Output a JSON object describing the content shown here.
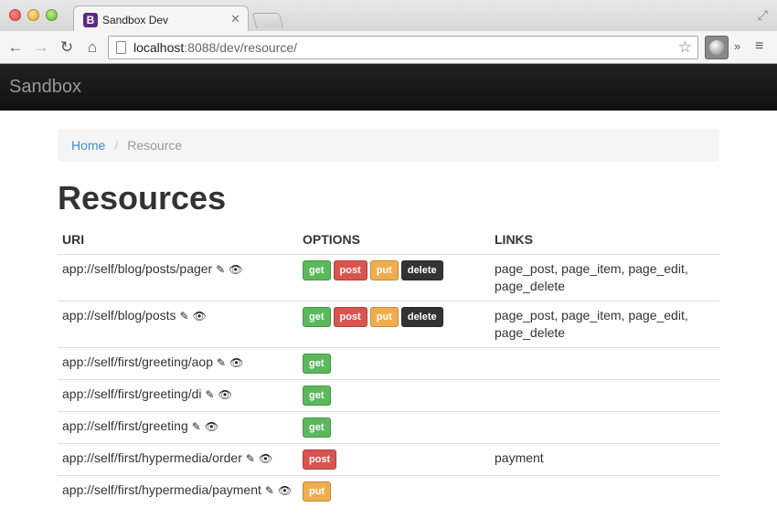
{
  "browser": {
    "tab_title": "Sandbox Dev",
    "favicon_letter": "B",
    "url_host": "localhost",
    "url_rest": ":8088/dev/resource/"
  },
  "navbar": {
    "brand": "Sandbox"
  },
  "breadcrumb": {
    "home": "Home",
    "current": "Resource",
    "separator": "/"
  },
  "page_title": "Resources",
  "table": {
    "headers": {
      "uri": "URI",
      "options": "OPTIONS",
      "links": "LINKS"
    },
    "rows": [
      {
        "uri": "app://self/blog/posts/pager",
        "options": [
          "get",
          "post",
          "put",
          "delete"
        ],
        "links": "page_post, page_item, page_edit, page_delete"
      },
      {
        "uri": "app://self/blog/posts",
        "options": [
          "get",
          "post",
          "put",
          "delete"
        ],
        "links": "page_post, page_item, page_edit, page_delete"
      },
      {
        "uri": "app://self/first/greeting/aop",
        "options": [
          "get"
        ],
        "links": ""
      },
      {
        "uri": "app://self/first/greeting/di",
        "options": [
          "get"
        ],
        "links": ""
      },
      {
        "uri": "app://self/first/greeting",
        "options": [
          "get"
        ],
        "links": ""
      },
      {
        "uri": "app://self/first/hypermedia/order",
        "options": [
          "post"
        ],
        "links": "payment"
      },
      {
        "uri": "app://self/first/hypermedia/payment",
        "options": [
          "put"
        ],
        "links": ""
      }
    ]
  },
  "colors": {
    "get": "#5cb85c",
    "post": "#d9534f",
    "put": "#f0ad4e",
    "delete": "#333333",
    "link": "#428bca"
  },
  "icons": {
    "edit": "edit-icon",
    "view": "eye-icon"
  }
}
